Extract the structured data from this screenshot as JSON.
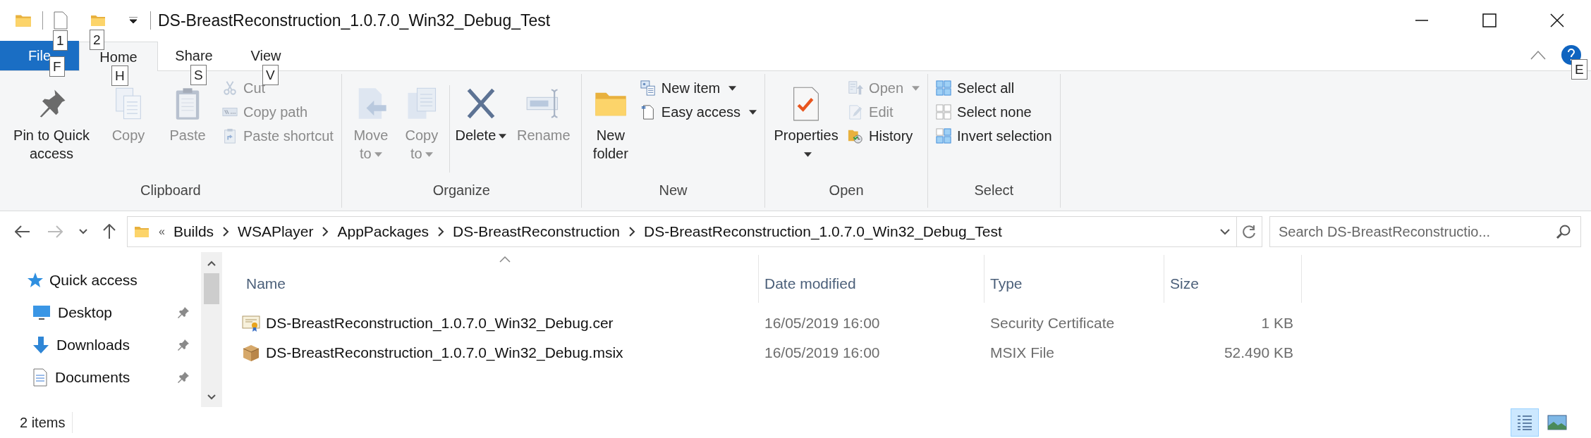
{
  "window": {
    "title": "DS-BreastReconstruction_1.0.7.0_Win32_Debug_Test"
  },
  "quick_access_toolbar": {
    "keytips": [
      "1",
      "2"
    ]
  },
  "ribbon_tabs": [
    {
      "label": "File",
      "keytip": "F",
      "selected": false,
      "kind": "file"
    },
    {
      "label": "Home",
      "keytip": "H",
      "selected": true,
      "kind": "tab"
    },
    {
      "label": "Share",
      "keytip": "S",
      "selected": false,
      "kind": "tab"
    },
    {
      "label": "View",
      "keytip": "V",
      "selected": false,
      "kind": "tab"
    }
  ],
  "help": {
    "keytip": "E"
  },
  "ribbon_groups": [
    {
      "label": "Clipboard",
      "items": [
        {
          "kind": "large",
          "label": "Pin to Quick access",
          "disabled": false,
          "dropdown": false
        },
        {
          "kind": "large",
          "label": "Copy",
          "disabled": true,
          "dropdown": false
        },
        {
          "kind": "large",
          "label": "Paste",
          "disabled": true,
          "dropdown": false
        },
        {
          "kind": "small",
          "label": "Cut",
          "disabled": true,
          "dropdown": false
        },
        {
          "kind": "small",
          "label": "Copy path",
          "disabled": true,
          "dropdown": false
        },
        {
          "kind": "small",
          "label": "Paste shortcut",
          "disabled": true,
          "dropdown": false
        }
      ]
    },
    {
      "label": "Organize",
      "items": [
        {
          "kind": "large",
          "label": "Move to",
          "disabled": true,
          "dropdown": true
        },
        {
          "kind": "large",
          "label": "Copy to",
          "disabled": true,
          "dropdown": true
        },
        {
          "kind": "separator"
        },
        {
          "kind": "large",
          "label": "Delete",
          "disabled": false,
          "dropdown": true
        },
        {
          "kind": "large",
          "label": "Rename",
          "disabled": true,
          "dropdown": false
        }
      ]
    },
    {
      "label": "New",
      "items": [
        {
          "kind": "large",
          "label": "New folder",
          "disabled": false,
          "dropdown": false
        },
        {
          "kind": "small",
          "label": "New item",
          "disabled": false,
          "dropdown": true
        },
        {
          "kind": "small",
          "label": "Easy access",
          "disabled": false,
          "dropdown": true
        }
      ]
    },
    {
      "label": "Open",
      "items": [
        {
          "kind": "large",
          "label": "Properties",
          "disabled": false,
          "dropdown": true
        },
        {
          "kind": "small",
          "label": "Open",
          "disabled": true,
          "dropdown": true
        },
        {
          "kind": "small",
          "label": "Edit",
          "disabled": true,
          "dropdown": false
        },
        {
          "kind": "small",
          "label": "History",
          "disabled": false,
          "dropdown": false
        }
      ]
    },
    {
      "label": "Select",
      "items": [
        {
          "kind": "small",
          "label": "Select all",
          "disabled": false,
          "dropdown": false
        },
        {
          "kind": "small",
          "label": "Select none",
          "disabled": false,
          "dropdown": false
        },
        {
          "kind": "small",
          "label": "Invert selection",
          "disabled": false,
          "dropdown": false
        }
      ]
    }
  ],
  "address_bar": {
    "overflow": "«",
    "path": [
      "Builds",
      "WSAPlayer",
      "AppPackages",
      "DS-BreastReconstruction",
      "DS-BreastReconstruction_1.0.7.0_Win32_Debug_Test"
    ]
  },
  "search": {
    "placeholder": "Search DS-BreastReconstructio..."
  },
  "navigation_pane": {
    "items": [
      {
        "label": "Quick access",
        "kind": "header",
        "pinned": false
      },
      {
        "label": "Desktop",
        "kind": "item",
        "pinned": true
      },
      {
        "label": "Downloads",
        "kind": "item",
        "pinned": true
      },
      {
        "label": "Documents",
        "kind": "item",
        "pinned": true
      }
    ]
  },
  "file_list": {
    "columns": [
      {
        "label": "Name",
        "sorted": true
      },
      {
        "label": "Date modified",
        "sorted": false
      },
      {
        "label": "Type",
        "sorted": false
      },
      {
        "label": "Size",
        "sorted": false
      }
    ],
    "rows": [
      {
        "name": "DS-BreastReconstruction_1.0.7.0_Win32_Debug.cer",
        "date_modified": "16/05/2019 16:00",
        "type": "Security Certificate",
        "size": "1 KB",
        "selected": false
      },
      {
        "name": "DS-BreastReconstruction_1.0.7.0_Win32_Debug.msix",
        "date_modified": "16/05/2019 16:00",
        "type": "MSIX File",
        "size": "52.490 KB",
        "selected": false
      }
    ]
  },
  "status_bar": {
    "text": "2 items",
    "views": [
      {
        "selected": true
      },
      {
        "selected": false
      }
    ]
  }
}
